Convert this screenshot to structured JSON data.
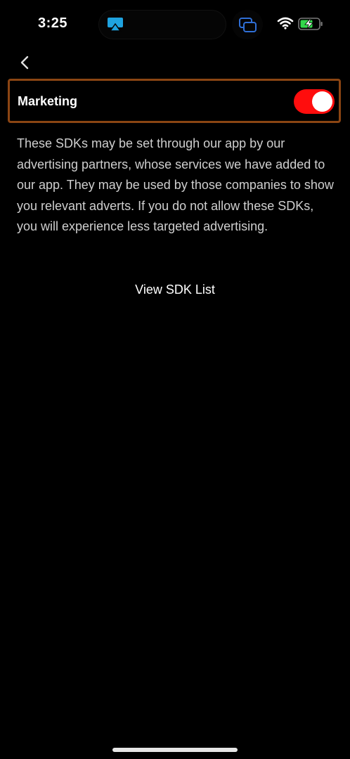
{
  "status_bar": {
    "time": "3:25",
    "icons": [
      "airplay-icon",
      "screen-mirror-icon",
      "wifi-icon",
      "battery-charging-icon"
    ],
    "accent": "#1e90ff",
    "battery_color": "#32d74b"
  },
  "nav": {
    "back_icon": "chevron-left-icon"
  },
  "setting": {
    "label": "Marketing",
    "toggle_on": true,
    "toggle_color": "#ff0d0d",
    "highlight_border_color": "#8b4513"
  },
  "description": "These SDKs may be set through our app by our advertising partners, whose services we have added to our app. They may be used by those companies to show you relevant adverts. If you do not allow these SDKs, you will experience less targeted advertising.",
  "links": {
    "view_sdk_list": "View SDK List"
  }
}
